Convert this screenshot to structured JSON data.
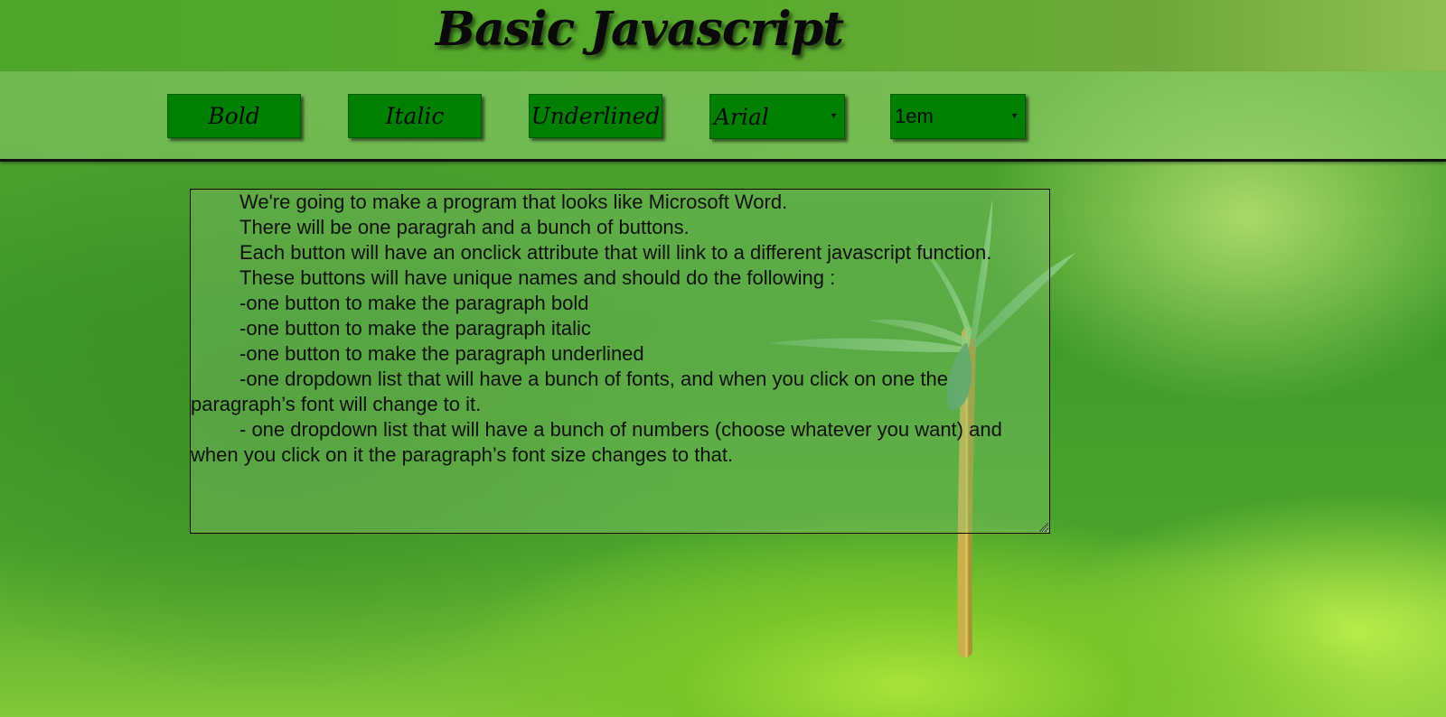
{
  "header": {
    "title": "Basic Javascript"
  },
  "toolbar": {
    "bold_label": "Bold",
    "italic_label": "Italic",
    "underlined_label": "Underlined",
    "font_select": {
      "selected": "Arial"
    },
    "size_select": {
      "selected": "1em"
    }
  },
  "editor": {
    "paragraphs": [
      "We're going to make a program that looks like Microsoft Word.",
      "There will be one paragrah and a bunch of buttons.",
      "Each button will have an onclick attribute that will link to a different javascript function.",
      "These buttons will have unique names and should do the following :",
      "-one button to make the paragraph bold",
      "-one button to make the paragraph italic",
      "-one button to make the paragraph underlined",
      "-one dropdown list that will have a bunch of fonts, and when you click on one the paragraph’s font will change to it.",
      "- one dropdown list that will have a bunch of numbers (choose whatever you want) and when you click on it the paragraph’s font size changes to that."
    ]
  },
  "colors": {
    "button_bg": "#008000",
    "header_bg": "#4ea62a",
    "text": "#0a0a0a"
  }
}
